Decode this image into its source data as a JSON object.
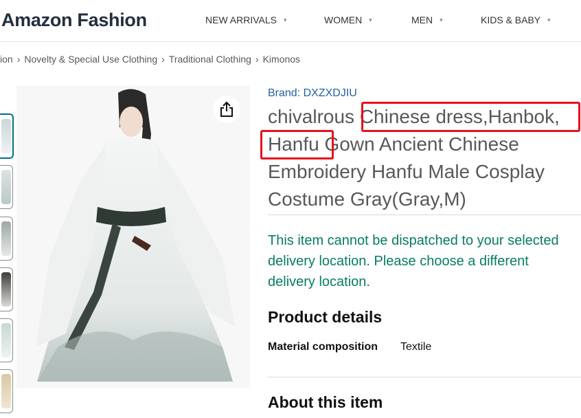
{
  "header": {
    "brand": "Amazon Fashion",
    "nav": [
      "NEW ARRIVALS",
      "WOMEN",
      "MEN",
      "KIDS & BABY"
    ]
  },
  "breadcrumb": [
    "ion",
    "Novelty & Special Use Clothing",
    "Traditional Clothing",
    "Kimonos"
  ],
  "product": {
    "brand_line": "Brand: DXZXDJIU",
    "title": "chivalrous Chinese dress,Hanbok, Hanfu Gown Ancient Chinese Embroidery Hanfu Male Cosplay Costume Gray(Gray,M)",
    "delivery_message": "This item cannot be dispatched to your selected delivery location. Please choose a different delivery location.",
    "details_heading": "Product details",
    "details": [
      {
        "label": "Material composition",
        "value": "Textile"
      }
    ],
    "about_heading": "About this item"
  },
  "icons": {
    "share": "share-icon",
    "chevron": "chevron-down-icon"
  },
  "colors": {
    "highlight": "#e8101e",
    "delivery": "#067d62",
    "brand_link": "#2162a1"
  }
}
